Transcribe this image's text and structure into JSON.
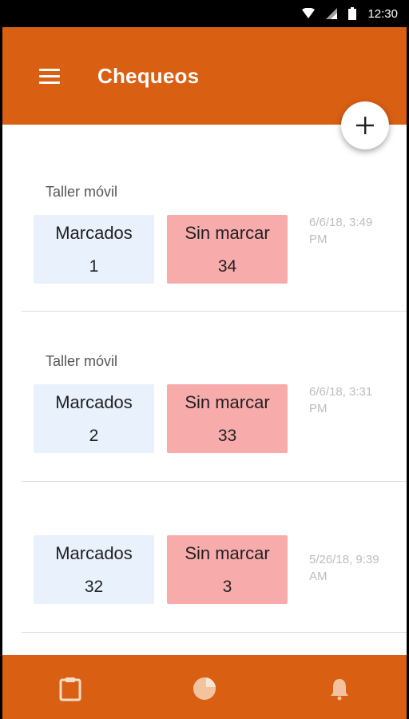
{
  "status_bar": {
    "time": "12:30",
    "icons": [
      "wifi-icon",
      "signal-icon",
      "battery-icon"
    ]
  },
  "app_bar": {
    "title": "Chequeos",
    "menu_icon": "menu-icon",
    "color": "#d95f12"
  },
  "fab": {
    "icon": "add-icon"
  },
  "cards": [
    {
      "title": "Taller móvil",
      "marked_label": "Marcados",
      "marked_count": "1",
      "unmarked_label": "Sin marcar",
      "unmarked_count": "34",
      "date": "6/6/18, 3:49 PM"
    },
    {
      "title": "Taller móvil",
      "marked_label": "Marcados",
      "marked_count": "2",
      "unmarked_label": "Sin marcar",
      "unmarked_count": "33",
      "date": "6/6/18, 3:31 PM"
    },
    {
      "title": "",
      "marked_label": "Marcados",
      "marked_count": "32",
      "unmarked_label": "Sin marcar",
      "unmarked_count": "3",
      "date": "5/26/18, 9:39 AM"
    }
  ],
  "bottom_nav": {
    "items": [
      "clipboard-icon",
      "pie-chart-icon",
      "bell-icon"
    ]
  },
  "colors": {
    "accent": "#d95f12",
    "marked_bg": "#e9f1fd",
    "unmarked_bg": "#f8abab"
  }
}
